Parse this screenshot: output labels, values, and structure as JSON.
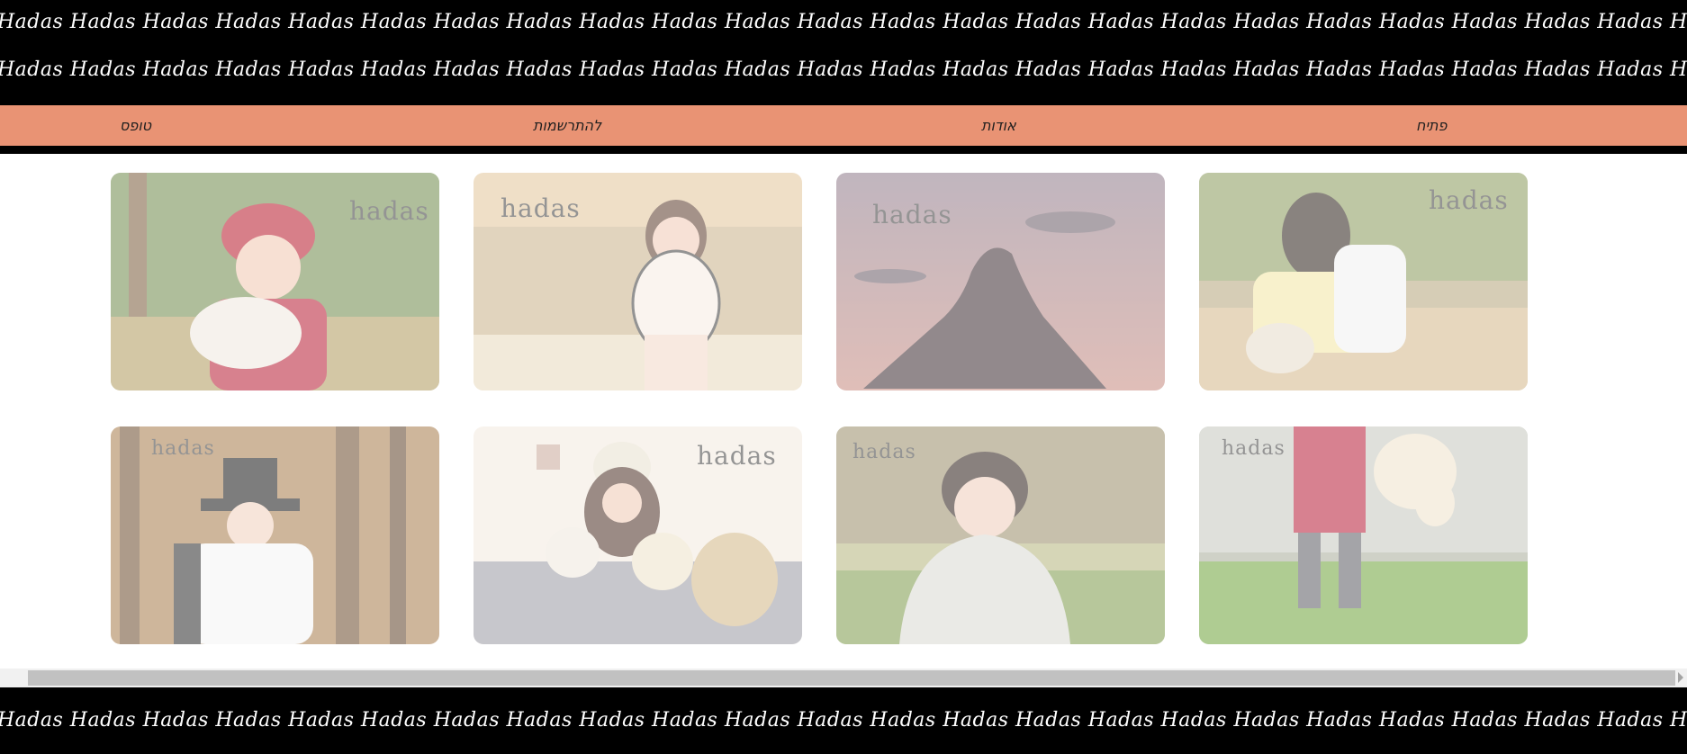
{
  "banner_text": "Hadas Hadas Hadas Hadas Hadas Hadas Hadas Hadas Hadas Hadas Hadas Hadas Hadas Hadas Hadas Hadas Hadas Hadas Hadas Hadas Hadas Hadas Hadas Hadas Hadas Hadas Hadas Hadas",
  "nav": {
    "home": "פתיח",
    "about": "אודות",
    "register": "להתרשמות",
    "form": "טופס"
  },
  "gallery": [
    {
      "watermark": "hadas",
      "icon": "photo-girl-red-flower-crown"
    },
    {
      "watermark": "hadas",
      "icon": "photo-girl-with-hat-lake"
    },
    {
      "watermark": "hadas",
      "icon": "photo-silhouette-sunset"
    },
    {
      "watermark": "hadas",
      "icon": "photo-girl-sitting-teddy"
    },
    {
      "watermark": "hadas",
      "icon": "photo-girl-top-hat-forest"
    },
    {
      "watermark": "hadas",
      "icon": "photo-girl-with-teddies-bed"
    },
    {
      "watermark": "hadas",
      "icon": "photo-toddler-silver-jacket"
    },
    {
      "watermark": "hadas",
      "icon": "photo-child-red-dress-teddy"
    }
  ],
  "colors": {
    "banner": "#000000",
    "nav_background": "#e99374",
    "page_background": "#ffffff"
  }
}
